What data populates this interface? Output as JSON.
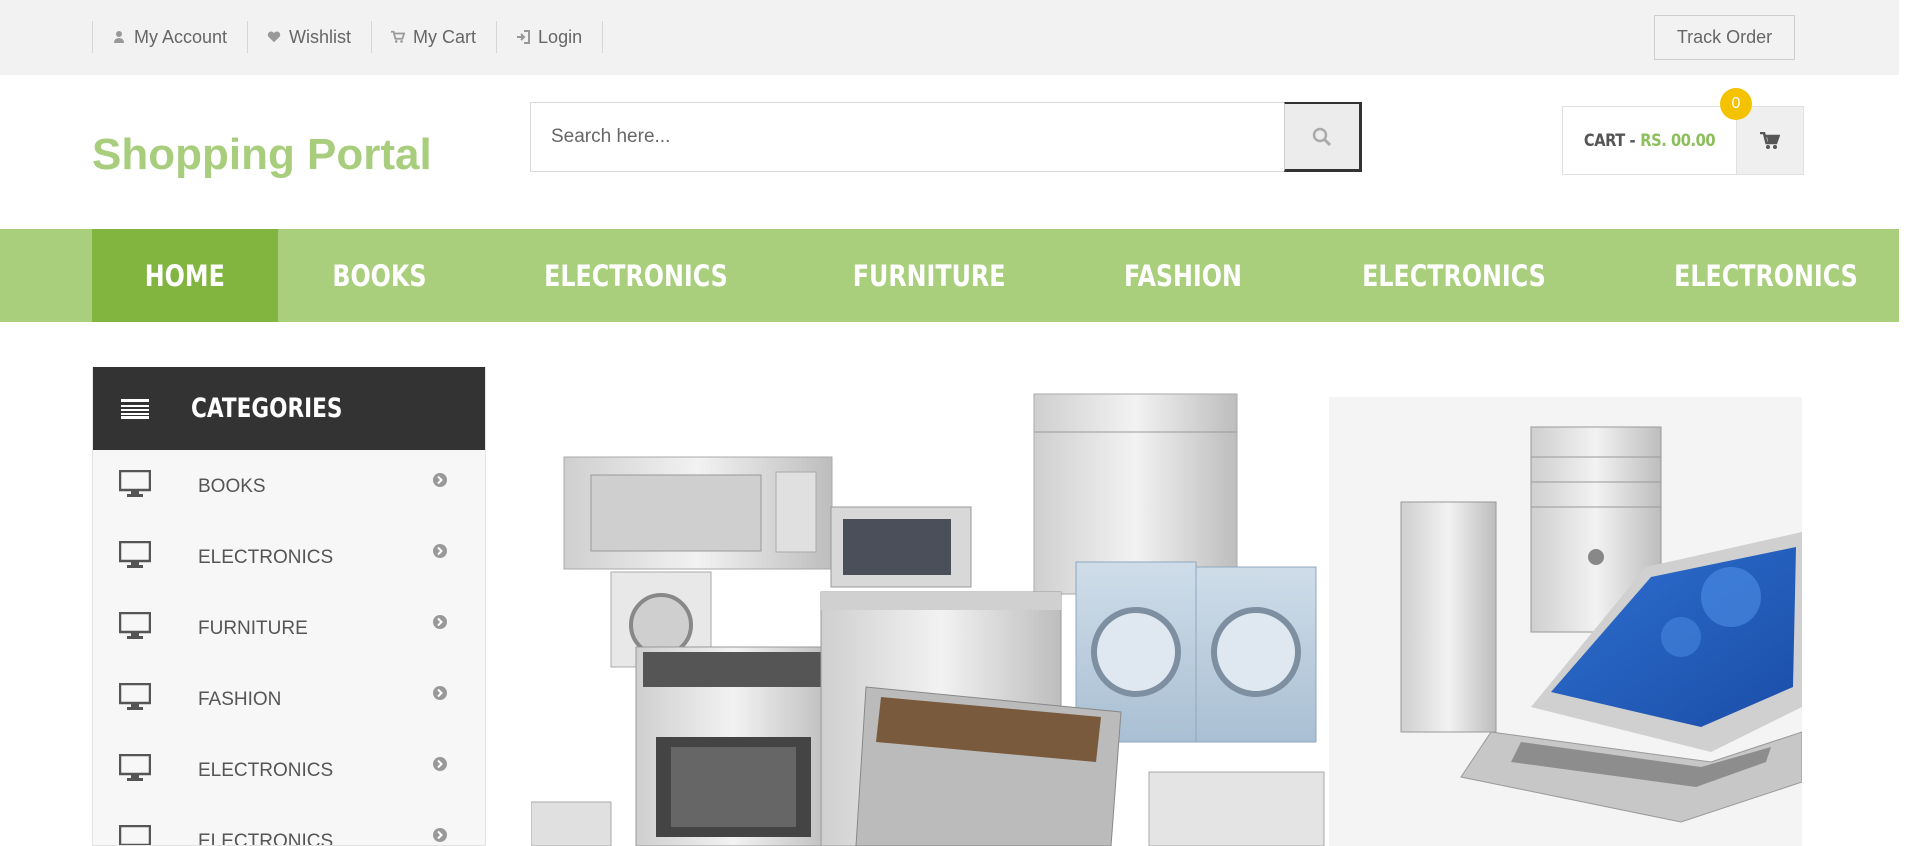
{
  "topbar": {
    "links": [
      {
        "label": "My Account",
        "icon": "user-icon"
      },
      {
        "label": "Wishlist",
        "icon": "heart-icon"
      },
      {
        "label": "My Cart",
        "icon": "cart-icon"
      },
      {
        "label": "Login",
        "icon": "login-icon"
      }
    ],
    "track_order": "Track Order"
  },
  "header": {
    "logo": "Shopping Portal",
    "search_placeholder": "Search here...",
    "search_value": "",
    "cart_label": "CART -",
    "cart_amount": "RS. 00.00",
    "cart_count": "0"
  },
  "nav": {
    "items": [
      "HOME",
      "BOOKS",
      "ELECTRONICS",
      "FURNITURE",
      "FASHION",
      "ELECTRONICS",
      "ELECTRONICS"
    ],
    "active_index": 0
  },
  "sidebar": {
    "title": "CATEGORIES",
    "items": [
      "BOOKS",
      "ELECTRONICS",
      "FURNITURE",
      "FASHION",
      "ELECTRONICS",
      "ELECTRONICS"
    ]
  },
  "colors": {
    "brand": "#a8ce7d",
    "nav_bg": "#a9cf7d",
    "nav_active": "#82b440",
    "badge": "#f5c200",
    "dark": "#333333"
  }
}
